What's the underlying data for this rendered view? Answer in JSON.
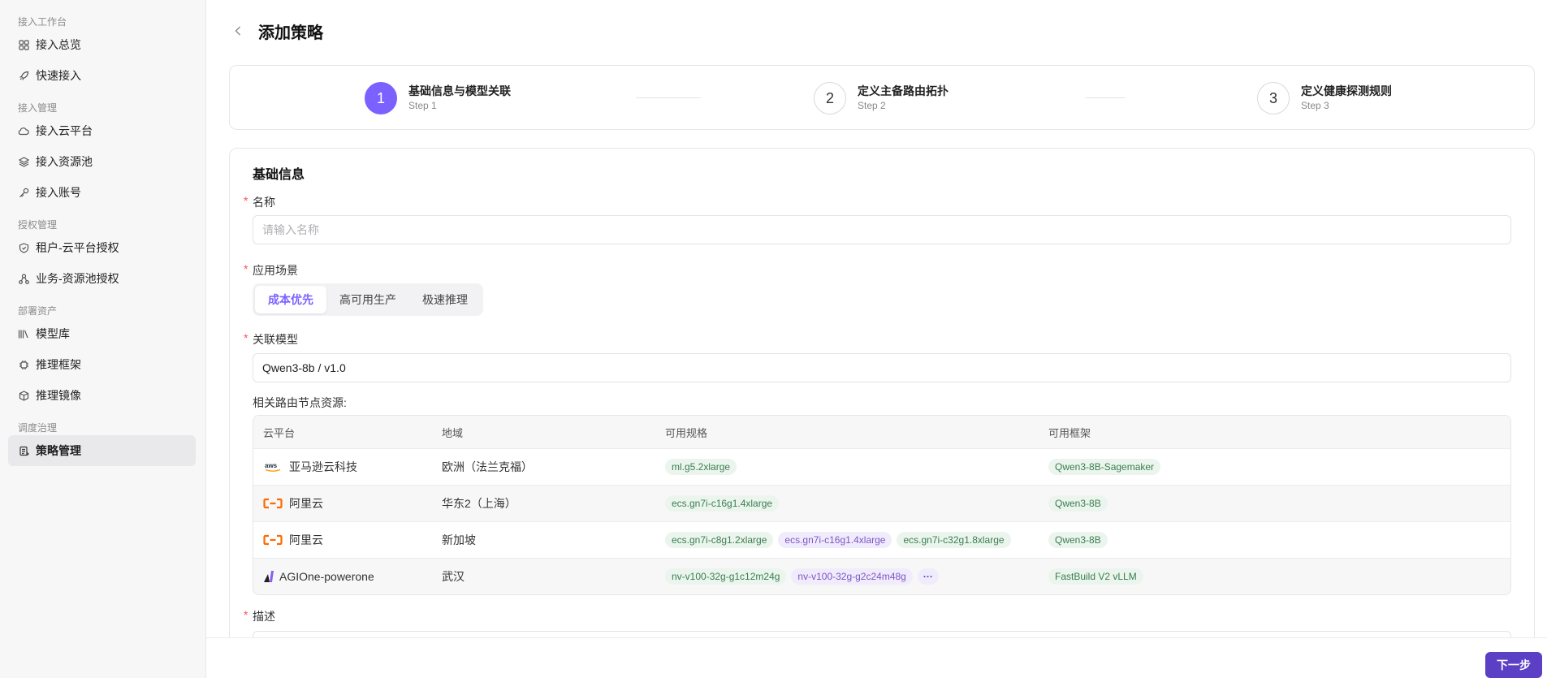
{
  "sidebar": {
    "groups": [
      {
        "title": "接入工作台",
        "items": [
          {
            "label": "接入总览",
            "icon": "grid-icon"
          },
          {
            "label": "快速接入",
            "icon": "rocket-icon"
          }
        ]
      },
      {
        "title": "接入管理",
        "items": [
          {
            "label": "接入云平台",
            "icon": "cloud-icon"
          },
          {
            "label": "接入资源池",
            "icon": "layers-icon"
          },
          {
            "label": "接入账号",
            "icon": "key-icon"
          }
        ]
      },
      {
        "title": "授权管理",
        "items": [
          {
            "label": "租户-云平台授权",
            "icon": "shield-icon"
          },
          {
            "label": "业务-资源池授权",
            "icon": "nodes-icon"
          }
        ]
      },
      {
        "title": "部署资产",
        "items": [
          {
            "label": "模型库",
            "icon": "library-icon"
          },
          {
            "label": "推理框架",
            "icon": "chip-icon"
          },
          {
            "label": "推理镜像",
            "icon": "box-icon"
          }
        ]
      },
      {
        "title": "调度治理",
        "items": [
          {
            "label": "策略管理",
            "icon": "policy-icon",
            "active": true
          }
        ]
      }
    ]
  },
  "header": {
    "title": "添加策略",
    "back_icon": "chevron-left-icon"
  },
  "steps": [
    {
      "num": "1",
      "title": "基础信息与模型关联",
      "sub": "Step 1",
      "active": true
    },
    {
      "num": "2",
      "title": "定义主备路由拓扑",
      "sub": "Step 2"
    },
    {
      "num": "3",
      "title": "定义健康探测规则",
      "sub": "Step 3"
    }
  ],
  "form": {
    "section_title": "基础信息",
    "required_mark": "*",
    "name_label": "名称",
    "name_placeholder": "请输入名称",
    "scene_label": "应用场景",
    "scene_options": [
      "成本优先",
      "高可用生产",
      "极速推理"
    ],
    "scene_selected": "成本优先",
    "model_label": "关联模型",
    "model_value": "Qwen3-8b / v1.0",
    "resources_label": "相关路由节点资源:",
    "desc_label": "描述"
  },
  "table": {
    "headers": [
      "云平台",
      "地域",
      "可用规格",
      "可用框架"
    ],
    "rows": [
      {
        "logo": "aws-logo",
        "platform": "亚马逊云科技",
        "region": "欧洲（法兰克福）",
        "specs": [
          "ml.g5.2xlarge"
        ],
        "spec_tone": "green",
        "frameworks": [
          "Qwen3-8B-Sagemaker"
        ]
      },
      {
        "logo": "aliyun-logo",
        "platform": "阿里云",
        "region": "华东2（上海）",
        "specs": [
          "ecs.gn7i-c16g1.4xlarge"
        ],
        "spec_tone": "green",
        "frameworks": [
          "Qwen3-8B"
        ]
      },
      {
        "logo": "aliyun-logo",
        "platform": "阿里云",
        "region": "新加坡",
        "specs": [
          "ecs.gn7i-c8g1.2xlarge",
          "ecs.gn7i-c16g1.4xlarge",
          "ecs.gn7i-c32g1.8xlarge"
        ],
        "spec_tone": "mixed",
        "frameworks": [
          "Qwen3-8B"
        ]
      },
      {
        "logo": "agione-logo",
        "platform": "AGIOne-powerone",
        "region": "武汉",
        "specs": [
          "nv-v100-32g-g1c12m24g",
          "nv-v100-32g-g2c24m48g"
        ],
        "spec_tone": "green-purple",
        "more": "···",
        "frameworks": [
          "FastBuild V2 vLLM"
        ]
      }
    ]
  },
  "footer": {
    "next_label": "下一步"
  },
  "colors": {
    "accent": "#7b61ff",
    "primary_button": "#5b3fc4",
    "required": "#ff4d4f"
  }
}
